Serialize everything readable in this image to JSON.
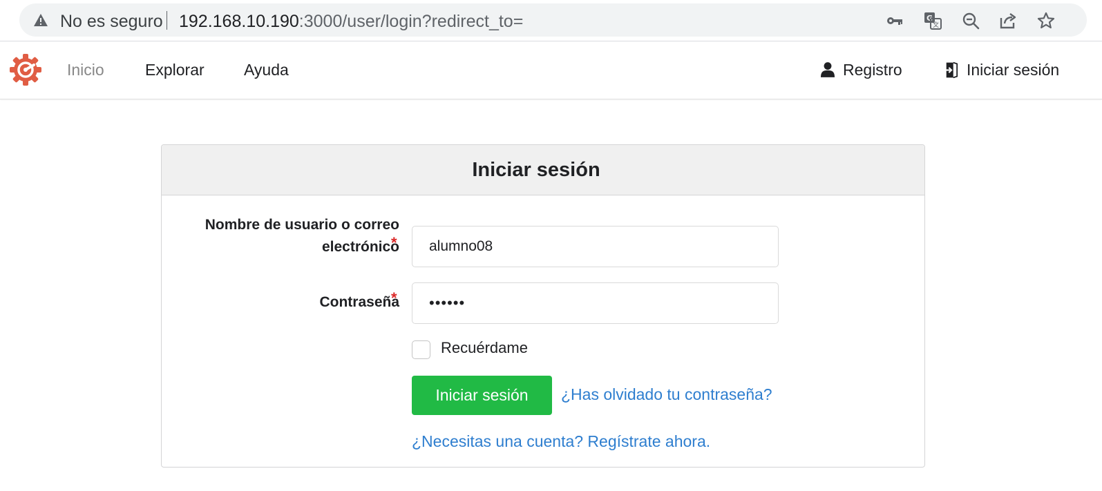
{
  "browser": {
    "security_label": "No es seguro",
    "url_host": "192.168.10.190",
    "url_path": ":3000/user/login?redirect_to=",
    "icons": [
      "key-icon",
      "translate-icon",
      "zoom-out-icon",
      "share-icon",
      "star-icon"
    ]
  },
  "navbar": {
    "logo": "gitea-logo",
    "items": [
      {
        "label": "Inicio",
        "active": true
      },
      {
        "label": "Explorar"
      },
      {
        "label": "Ayuda"
      }
    ],
    "right": {
      "register_label": "Registro",
      "signin_label": "Iniciar sesión"
    }
  },
  "login": {
    "title": "Iniciar sesión",
    "username": {
      "label_line1": "Nombre de usuario o correo",
      "label_line2": "electrónico",
      "required_mark": "*",
      "value": "alumno08"
    },
    "password": {
      "label": "Contraseña",
      "required_mark": "*",
      "value": "••••••"
    },
    "remember_label": "Recuérdame",
    "remember_checked": false,
    "submit_label": "Iniciar sesión",
    "forgot_link": "¿Has olvidado tu contraseña?",
    "register_link": "¿Necesitas una cuenta? Regístrate ahora."
  },
  "colors": {
    "primary_button": "#21ba45",
    "link": "#2e7ecf",
    "required": "#db2828",
    "logo": "#e05d44"
  }
}
